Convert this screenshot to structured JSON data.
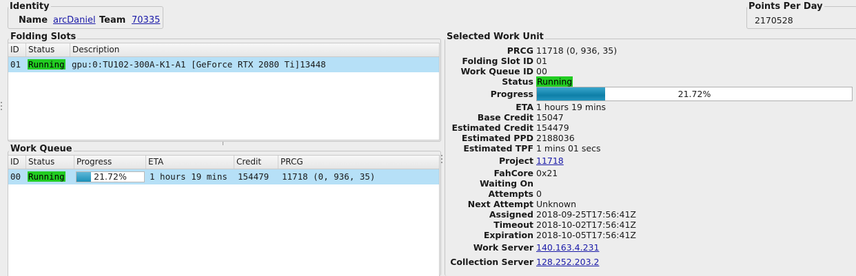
{
  "identity": {
    "title": "Identity",
    "name_label": "Name",
    "name_value": "arcDaniel",
    "team_label": "Team",
    "team_value": "70335"
  },
  "ppd": {
    "title": "Points Per Day",
    "value": "2170528"
  },
  "slots": {
    "title": "Folding Slots",
    "columns": [
      "ID",
      "Status",
      "Description"
    ],
    "rows": [
      {
        "id": "01",
        "status": "Running",
        "description": "gpu:0:TU102-300A-K1-A1 [GeForce RTX 2080 Ti]13448"
      }
    ]
  },
  "queue": {
    "title": "Work Queue",
    "columns": [
      "ID",
      "Status",
      "Progress",
      "ETA",
      "Credit",
      "PRCG"
    ],
    "rows": [
      {
        "id": "00",
        "status": "Running",
        "progress": "21.72%",
        "progress_fraction": 0.2172,
        "eta": "1 hours 19 mins",
        "credit": "154479",
        "prcg": "11718 (0, 936, 35)"
      }
    ]
  },
  "wu": {
    "title": "Selected Work Unit",
    "prcg_label": "PRCG",
    "prcg": "11718 (0, 936, 35)",
    "slot_label": "Folding Slot ID",
    "slot": "01",
    "queue_label": "Work Queue ID",
    "queue": "00",
    "status_label": "Status",
    "status": "Running",
    "progress_label": "Progress",
    "progress": "21.72%",
    "progress_fraction": 0.2172,
    "eta_label": "ETA",
    "eta": "1 hours 19 mins",
    "base_credit_label": "Base Credit",
    "base_credit": "15047",
    "est_credit_label": "Estimated Credit",
    "est_credit": "154479",
    "est_ppd_label": "Estimated PPD",
    "est_ppd": "2188036",
    "est_tpf_label": "Estimated TPF",
    "est_tpf": "1 mins 01 secs",
    "project_label": "Project",
    "project": "11718",
    "fahcore_label": "FahCore",
    "fahcore": "0x21",
    "waiting_label": "Waiting On",
    "waiting": "",
    "attempts_label": "Attempts",
    "attempts": "0",
    "next_attempt_label": "Next Attempt",
    "next_attempt": "Unknown",
    "assigned_label": "Assigned",
    "assigned": "2018-09-25T17:56:41Z",
    "timeout_label": "Timeout",
    "timeout": "2018-10-02T17:56:41Z",
    "expiration_label": "Expiration",
    "expiration": "2018-10-05T17:56:41Z",
    "work_server_label": "Work Server",
    "work_server": "140.163.4.231",
    "collection_server_label": "Collection Server",
    "collection_server": "128.252.203.2"
  },
  "colors": {
    "running": "#22cc22",
    "selection": "#b6e0f7",
    "link": "#1a1aa8",
    "progress_fill": "#1b90b8"
  }
}
